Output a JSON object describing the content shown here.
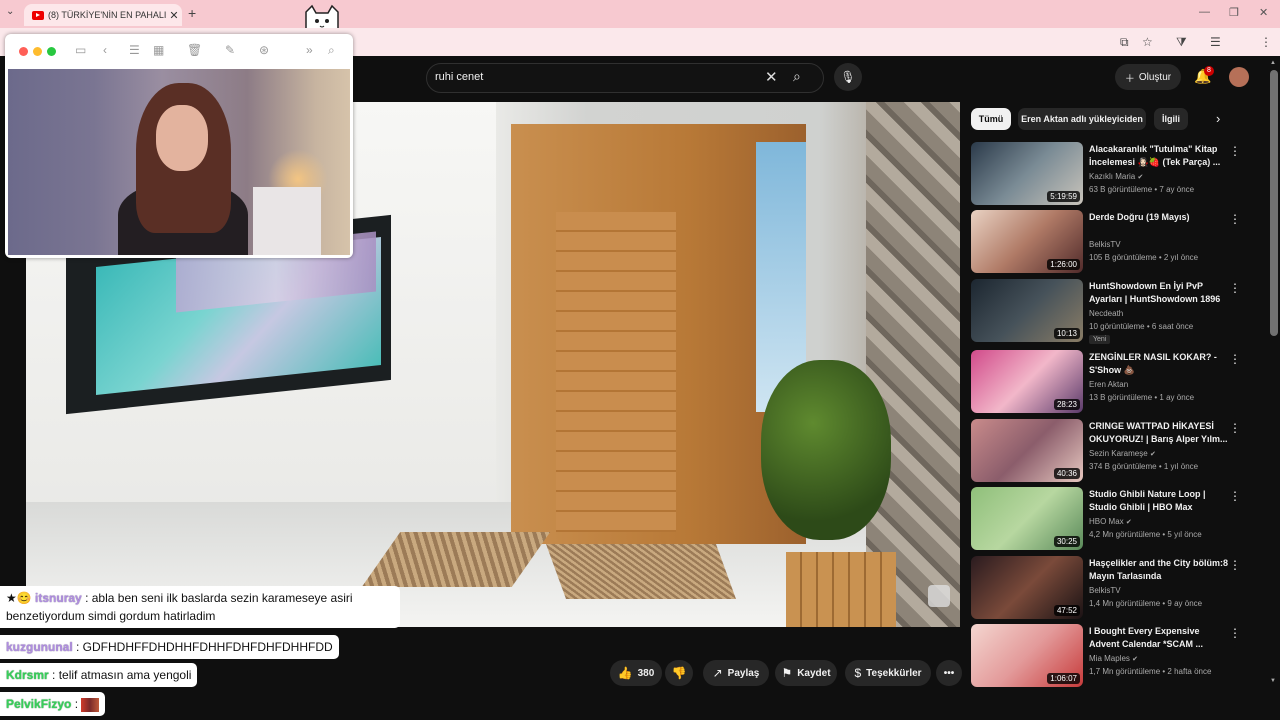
{
  "browser": {
    "tab_title": "(8) TÜRKİYE'NİN EN PAHALI EV...",
    "tab_close": "✕",
    "new_tab": "+",
    "window_controls": [
      "—",
      "❐",
      "✕"
    ]
  },
  "cam_toolbar": {
    "dot_colors": [
      "#ff5f57",
      "#febc2e",
      "#28c840"
    ],
    "icons": [
      "sidebar-icon",
      "back-icon",
      "list-icon",
      "grid-icon",
      "trash-icon",
      "compose-icon",
      "share-icon",
      "forward-icon",
      "search-icon"
    ]
  },
  "youtube": {
    "search_query": "ruhi cenet",
    "create_label": "Oluştur",
    "notification_count": "8"
  },
  "chat": [
    {
      "user": "itsnuray",
      "text": ": abla ben seni ilk baslarda sezin karameseye asiri benzetiyordum simdi gordum hatirladim",
      "emote": "★😊"
    },
    {
      "user": "kuzgununal",
      "text": ": GDFHDHFFDHDHHFDHHFDHFDHFDHHFDD"
    },
    {
      "user": "Kdrsmr",
      "text": ": telif atmasın ama yengoli"
    },
    {
      "user": "PelvikFizyo",
      "text": ":"
    }
  ],
  "chips": [
    "Tümü",
    "Eren Aktan adlı yükleyiciden",
    "İlgili"
  ],
  "recommendations": [
    {
      "title": "Alacakaranlık \"Tutulma\" Kitap İncelemesi 🧛🏻‍♀️🍓 (Tek Parça) ...",
      "channel": "Kazıklı Maria",
      "verified": true,
      "meta": "63 B görüntüleme • 7 ay önce",
      "duration": "5:19:59",
      "thumb": "linear-gradient(135deg,#2b3a4a,#7a8b95 50%,#c9c4bb)"
    },
    {
      "title": "Derde Doğru (19 Mayıs)",
      "channel": "BelkisTV",
      "verified": false,
      "meta": "105 B görüntüleme • 2 yıl önce",
      "duration": "1:26:00",
      "thumb": "linear-gradient(135deg,#e9d2c3,#b07a66 50%,#512b2b)"
    },
    {
      "title": "HuntShowdown En İyi PvP Ayarları | HuntShowdown 1896",
      "channel": "Necdeath",
      "verified": false,
      "meta": "10 görüntüleme • 6 saat önce",
      "duration": "10:13",
      "badge": "Yeni",
      "thumb": "linear-gradient(135deg,#1c2630,#46525a 50%,#8a7d66)"
    },
    {
      "title": "ZENGİNLER NASIL KOKAR? - S'Show 💩",
      "channel": "Eren Aktan",
      "verified": false,
      "meta": "13 B görüntüleme • 1 ay önce",
      "duration": "28:23",
      "thumb": "linear-gradient(135deg,#d14a8a,#f2b7c9 50%,#5a3a6a)"
    },
    {
      "title": "CRINGE WATTPAD HİKAYESİ OKUYORUZ! | Barış Alper Yılm...",
      "channel": "Sezin Karameşe",
      "verified": true,
      "meta": "374 B görüntüleme • 1 yıl önce",
      "duration": "40:36",
      "thumb": "linear-gradient(135deg,#c98b8b,#8b5d6b 50%,#e7c8c0)"
    },
    {
      "title": "Studio Ghibli Nature Loop | Studio Ghibli | HBO Max",
      "channel": "HBO Max",
      "verified": true,
      "meta": "4,2 Mn görüntüleme • 5 yıl önce",
      "duration": "30:25",
      "thumb": "linear-gradient(135deg,#8fbf7a,#b7d7a0 50%,#5a8a5a)"
    },
    {
      "title": "Haşçelikler and the City bölüm:8 Mayın Tarlasında",
      "channel": "BelkisTV",
      "verified": false,
      "meta": "1,4 Mn görüntüleme • 9 ay önce",
      "duration": "47:52",
      "thumb": "linear-gradient(135deg,#2a1b1f,#7a4a3a 50%,#1a1214)"
    },
    {
      "title": "I Bought Every Expensive Advent Calendar *SCAM ...",
      "channel": "Mia Maples",
      "verified": true,
      "meta": "1,7 Mn görüntüleme • 2 hafta önce",
      "duration": "1:06:07",
      "thumb": "linear-gradient(135deg,#f4d6d0,#e39a9a 50%,#c73b3b)"
    }
  ],
  "actions": {
    "like_count": "380",
    "share": "Paylaş",
    "save": "Kaydet",
    "thanks": "Teşekkürler",
    "more": "•••"
  }
}
